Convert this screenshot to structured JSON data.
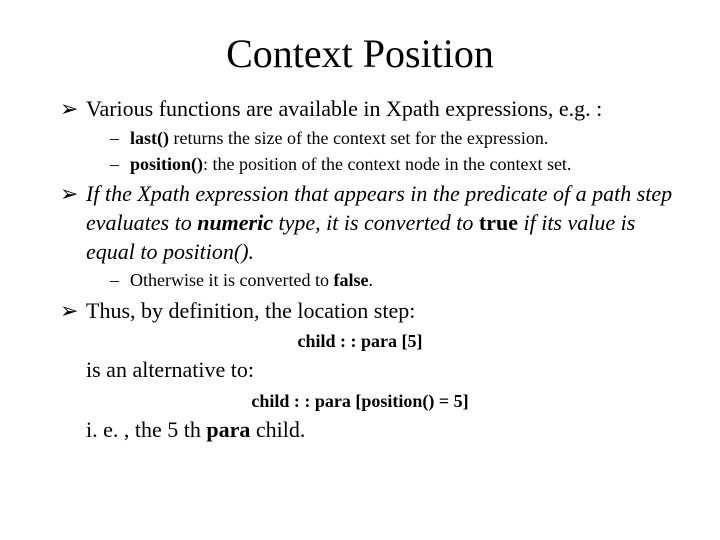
{
  "title": "Context Position",
  "b1": "Various functions are available in Xpath expressions, e.g. :",
  "s1a_fn": "last()",
  "s1a_rest": " returns the size of the context set for the expression.",
  "s1b_fn": "position()",
  "s1b_rest": ": the position of the context node in the context set.",
  "b2_if": "If",
  "b2_a": " the Xpath expression that appears in the predicate of a path step evaluates to ",
  "b2_numeric": "numeric",
  "b2_b": " type, it is converted to ",
  "b2_true": "true",
  "b2_c": " if its value is equal to position().",
  "s2_a": "Otherwise it is converted to ",
  "s2_false": "false",
  "s2_b": ".",
  "b3": "Thus, by definition, the location step:",
  "code1": "child : : para [5]",
  "alt": "is an alternative to:",
  "code2": "child : : para [position() = 5]",
  "ie_a": "i. e. , the 5 th ",
  "ie_para": "para",
  "ie_b": " child."
}
